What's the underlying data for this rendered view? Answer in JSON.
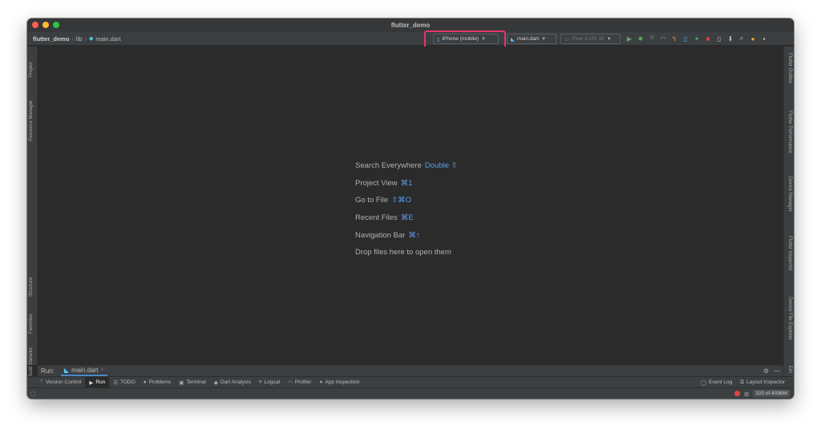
{
  "window": {
    "title": "flutter_demo"
  },
  "breadcrumb": {
    "project": "flutter_demo",
    "folder": "lib",
    "file": "main.dart"
  },
  "run_config": {
    "device": "iPhone (mobile)",
    "config": "main.dart",
    "emulator": "Pixel 3 API 30"
  },
  "toolbar_icons": [
    "run-icon",
    "debug-icon",
    "coverage-icon",
    "profile-icon",
    "hot-reload-icon",
    "attach-icon",
    "stop-icon",
    "avd-icon",
    "sdk-icon",
    "search-icon",
    "update-icon",
    "account-icon"
  ],
  "left_tabs": [
    "Project",
    "Resource Manager",
    "Structure",
    "Favorites",
    "Build Variants"
  ],
  "right_tabs": [
    "Flutter Outline",
    "Flutter Performance",
    "Device Manager",
    "Flutter Inspector",
    "Device File Explorer",
    "Em"
  ],
  "hints": [
    {
      "text": "Search Everywhere",
      "key": "Double ⇧"
    },
    {
      "text": "Project View",
      "key": "⌘1"
    },
    {
      "text": "Go to File",
      "key": "⇧⌘O"
    },
    {
      "text": "Recent Files",
      "key": "⌘E"
    },
    {
      "text": "Navigation Bar",
      "key": "⌘↑"
    },
    {
      "text": "Drop files here to open them",
      "key": ""
    }
  ],
  "run_panel": {
    "label": "Run:",
    "tab": "main.dart"
  },
  "tool_windows": {
    "version_control": "Version Control",
    "run": "Run",
    "todo": "TODO",
    "problems": "Problems",
    "terminal": "Terminal",
    "dart_analysis": "Dart Analysis",
    "logcat": "Logcat",
    "profiler": "Profiler",
    "app_inspection": "App Inspection",
    "event_log": "Event Log",
    "layout_inspector": "Layout Inspector"
  },
  "status": {
    "memory": "320 of 4096M"
  },
  "colors": {
    "highlight": "#e8336a",
    "accent": "#589df6",
    "background": "#2b2b2b"
  }
}
